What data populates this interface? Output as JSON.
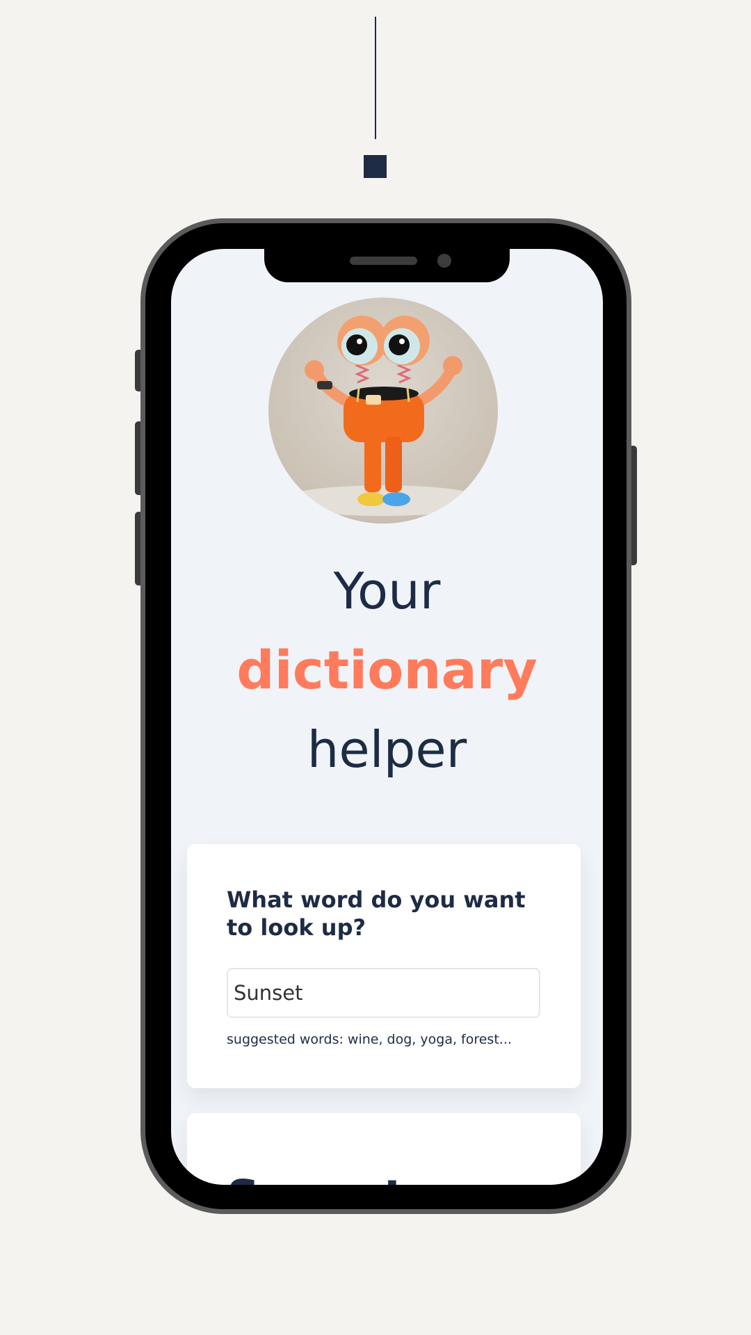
{
  "hero": {
    "line1": "Your",
    "line2": "dictionary",
    "line3": "helper"
  },
  "search": {
    "heading": "What word do you want to look up?",
    "value": "Sunset",
    "suggestions": "suggested words: wine, dog, yoga, forest..."
  },
  "result": {
    "word": "Sunset"
  },
  "colors": {
    "accent": "#ff7b5c",
    "navy": "#1e2b45",
    "page_background": "#f4f3f0",
    "screen_background": "#f0f4f8"
  }
}
